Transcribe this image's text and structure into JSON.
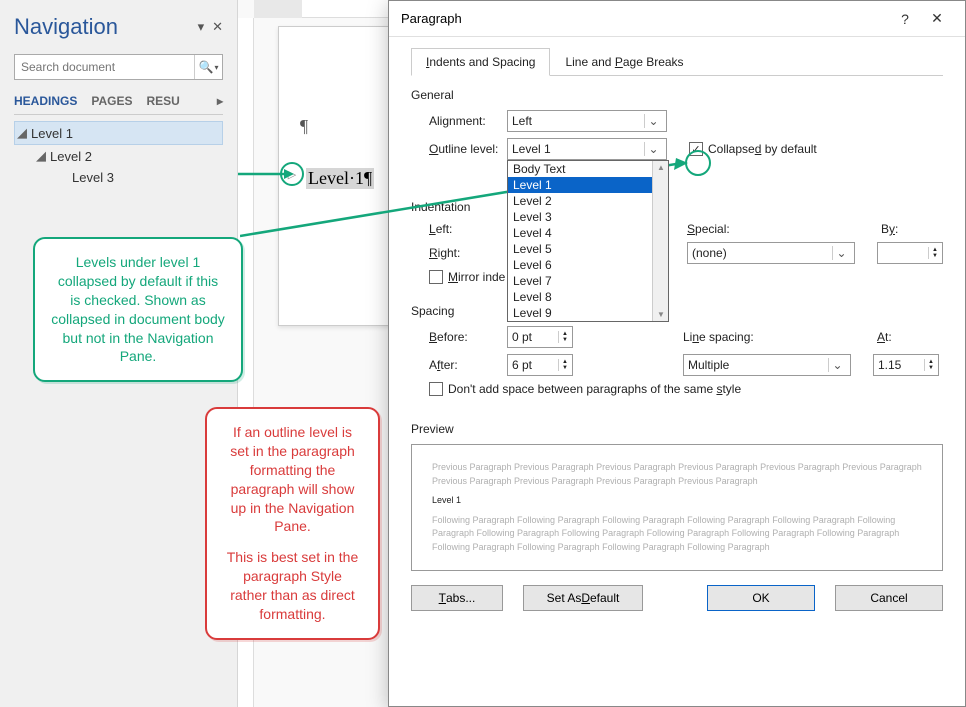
{
  "nav": {
    "title": "Navigation",
    "search_placeholder": "Search document",
    "tabs": {
      "headings": "HEADINGS",
      "pages": "PAGES",
      "results": "RESU"
    },
    "items": [
      {
        "label": "Level 1"
      },
      {
        "label": "Level 2"
      },
      {
        "label": "Level 3"
      }
    ]
  },
  "doc": {
    "pilcrow": "¶",
    "level1_text": "Level·1¶",
    "collapse_glyph": "▷"
  },
  "dialog": {
    "title": "Paragraph",
    "help": "?",
    "close": "✕",
    "tabs": {
      "indents": "Indents and Spacing",
      "breaks": "Line and Page Breaks"
    },
    "general": {
      "label": "General",
      "alignment_label": "Alignment:",
      "alignment_value": "Left",
      "outline_label": "Outline level:",
      "outline_value": "Level 1",
      "collapsed_label": "Collapsed by default",
      "collapsed_checked": "✓",
      "dropdown_options": [
        "Body Text",
        "Level 1",
        "Level 2",
        "Level 3",
        "Level 4",
        "Level 5",
        "Level 6",
        "Level 7",
        "Level 8",
        "Level 9"
      ]
    },
    "indentation": {
      "label": "Indentation",
      "left_label": "Left:",
      "right_label": "Right:",
      "mirror_label": "Mirror inde",
      "special_label": "Special:",
      "special_value": "(none)",
      "by_label": "By:"
    },
    "spacing": {
      "label": "Spacing",
      "before_label": "Before:",
      "before_value": "0 pt",
      "after_label": "After:",
      "after_value": "6 pt",
      "line_label": "Line spacing:",
      "line_value": "Multiple",
      "at_label": "At:",
      "at_value": "1.15",
      "dont_add_label": "Don't add space between paragraphs of the same style"
    },
    "preview": {
      "label": "Preview",
      "prev_text": "Previous Paragraph Previous Paragraph Previous Paragraph Previous Paragraph Previous Paragraph Previous Paragraph Previous Paragraph Previous Paragraph Previous Paragraph Previous Paragraph",
      "level_text": "Level 1",
      "next_text": "Following Paragraph Following Paragraph Following Paragraph Following Paragraph Following Paragraph Following Paragraph Following Paragraph Following Paragraph Following Paragraph Following Paragraph Following Paragraph Following Paragraph Following Paragraph Following Paragraph Following Paragraph"
    },
    "buttons": {
      "tabs": "Tabs...",
      "default": "Set As Default",
      "ok": "OK",
      "cancel": "Cancel"
    }
  },
  "callouts": {
    "green": "Levels under level 1 collapsed by default if this is checked. Shown as collapsed in document body but not in the Navigation Pane.",
    "red_p1": "If an outline level is set in the paragraph formatting the paragraph will show up in the Navigation Pane.",
    "red_p2": "This is best set in the paragraph Style rather than as direct formatting."
  }
}
